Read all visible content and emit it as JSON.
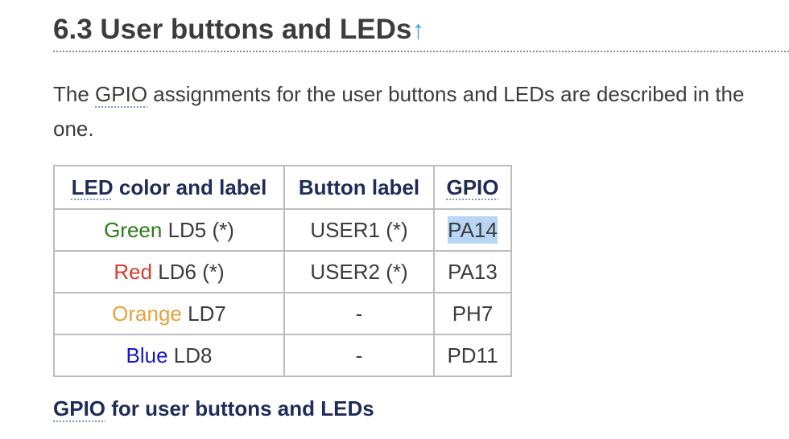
{
  "section": {
    "title": "6.3 User buttons and LEDs",
    "up_arrow": "↑"
  },
  "paragraph": {
    "prefix": "The ",
    "abbr": "GPIO",
    "line1_rest": " assignments for the user buttons and LEDs are described in the",
    "line2": "one."
  },
  "table": {
    "headers": {
      "col1_abbr": "LED",
      "col1_rest": " color and label",
      "col2": "Button label",
      "col3": "GPIO"
    },
    "rows": [
      {
        "color_word": "Green",
        "led": " LD5 (*)",
        "button": "USER1 (*)",
        "gpio": "PA14"
      },
      {
        "color_word": "Red",
        "led": " LD6 (*)",
        "button": "USER2 (*)",
        "gpio": "PA13"
      },
      {
        "color_word": "Orange",
        "led": " LD7",
        "button": "-",
        "gpio": "PH7"
      },
      {
        "color_word": "Blue",
        "led": " LD8",
        "button": "-",
        "gpio": "PD11"
      }
    ]
  },
  "caption": {
    "abbr": "GPIO",
    "rest": " for user buttons and LEDs"
  },
  "colors": {
    "green": "#2b7d1a",
    "red": "#d83a2b",
    "orange": "#e3a23a",
    "blue": "#1a15c9",
    "heading_link": "#36a3d9",
    "selection": "#b9d5f6"
  }
}
